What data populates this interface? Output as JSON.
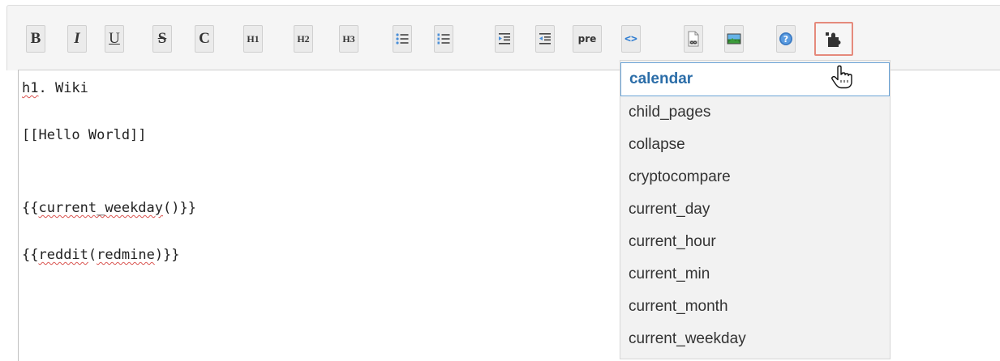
{
  "toolbar": {
    "buttons": [
      {
        "id": "bold",
        "glyph": "B"
      },
      {
        "id": "italic",
        "glyph": "I"
      },
      {
        "id": "underline",
        "glyph": "U"
      },
      {
        "id": "strike",
        "glyph": "S"
      },
      {
        "id": "code",
        "glyph": "C"
      },
      {
        "id": "h1",
        "glyph": "H1"
      },
      {
        "id": "h2",
        "glyph": "H2"
      },
      {
        "id": "h3",
        "glyph": "H3"
      },
      {
        "id": "ul",
        "icon": "unordered-list-icon"
      },
      {
        "id": "ol",
        "icon": "ordered-list-icon"
      },
      {
        "id": "indent",
        "icon": "indent-icon"
      },
      {
        "id": "outdent",
        "icon": "outdent-icon"
      },
      {
        "id": "pre",
        "glyph": "pre"
      },
      {
        "id": "code-highlight",
        "glyph": "<>"
      },
      {
        "id": "link",
        "icon": "link-icon"
      },
      {
        "id": "image",
        "icon": "image-icon"
      },
      {
        "id": "help",
        "icon": "help-icon"
      },
      {
        "id": "macro",
        "icon": "puzzle-icon",
        "active": true
      }
    ]
  },
  "editor": {
    "lines": [
      {
        "text": "h1. Wiki"
      },
      {
        "text": "[[Hello World]]"
      },
      {
        "text": "{{current_weekday()}}"
      },
      {
        "text": "{{reddit(redmine)}}"
      }
    ]
  },
  "macro_menu": {
    "items": [
      {
        "label": "calendar",
        "selected": true
      },
      {
        "label": "child_pages"
      },
      {
        "label": "collapse"
      },
      {
        "label": "cryptocompare"
      },
      {
        "label": "current_day"
      },
      {
        "label": "current_hour"
      },
      {
        "label": "current_min"
      },
      {
        "label": "current_month"
      },
      {
        "label": "current_weekday"
      }
    ]
  },
  "colors": {
    "selected_item_text": "#2b6da8",
    "selected_item_border": "#6aa3d6",
    "active_button_border": "#e58a7c",
    "spellcheck_underline": "#d9534f"
  }
}
